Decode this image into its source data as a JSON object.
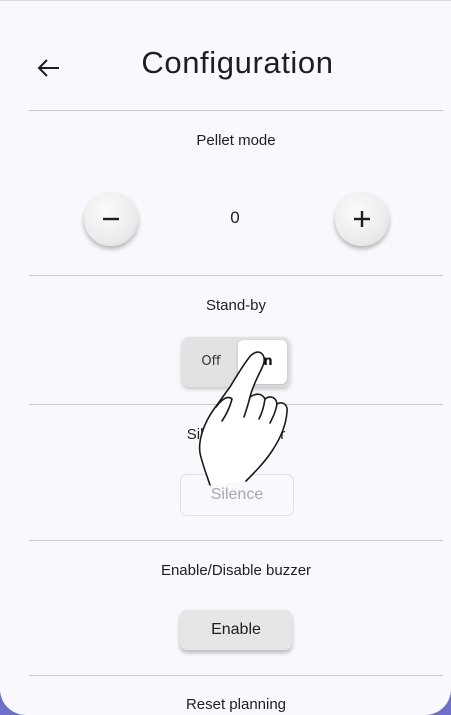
{
  "header": {
    "back_icon": "arrow-left-icon",
    "title": "Configuration"
  },
  "pellet_mode": {
    "label": "Pellet mode",
    "value": "0",
    "decrement_icon": "minus-icon",
    "increment_icon": "plus-icon"
  },
  "standby": {
    "label": "Stand-by",
    "off_label": "Off",
    "on_label": "On",
    "selected": "On"
  },
  "silence_buzzer": {
    "label": "Silence buzzer",
    "button_label": "Silence",
    "button_enabled": false
  },
  "buzzer_toggle": {
    "label": "Enable/Disable buzzer",
    "button_label": "Enable"
  },
  "reset_planning": {
    "label": "Reset planning"
  },
  "overlay": {
    "icon": "tap-hand-icon"
  },
  "colors": {
    "panel_background": "#f9f9fd",
    "accent_edge": "#6f6fc8",
    "divider": "#c9c9cf",
    "disabled_text": "#a9a9ad"
  }
}
